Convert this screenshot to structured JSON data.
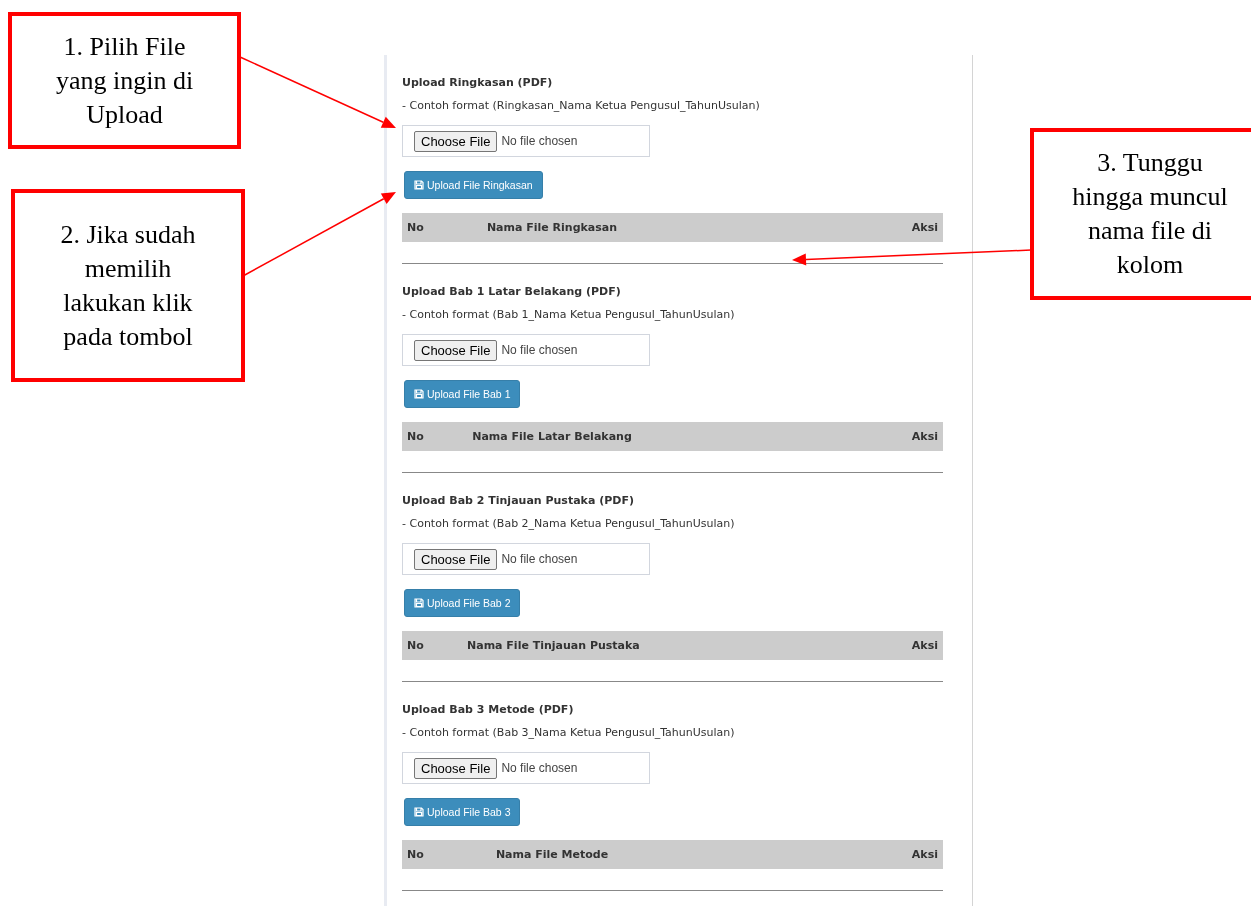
{
  "sections": [
    {
      "title": "Upload Ringkasan (PDF)",
      "hint": "- Contoh format (Ringkasan_Nama Ketua Pengusul_TahunUsulan)",
      "choose_button": "Choose File",
      "file_status": "No file chosen",
      "upload_button": "Upload File Ringkasan",
      "columns": [
        "No",
        "Nama File Ringkasan",
        "Aksi"
      ]
    },
    {
      "title": "Upload Bab 1 Latar Belakang (PDF)",
      "hint": "- Contoh format (Bab 1_Nama Ketua Pengusul_TahunUsulan)",
      "choose_button": "Choose File",
      "file_status": "No file chosen",
      "upload_button": "Upload File Bab 1",
      "columns": [
        "No",
        "Nama File Latar Belakang",
        "Aksi"
      ]
    },
    {
      "title": "Upload Bab 2 Tinjauan Pustaka (PDF)",
      "hint": "- Contoh format (Bab 2_Nama Ketua Pengusul_TahunUsulan)",
      "choose_button": "Choose File",
      "file_status": "No file chosen",
      "upload_button": "Upload File Bab 2",
      "columns": [
        "No",
        "Nama File Tinjauan Pustaka",
        "Aksi"
      ]
    },
    {
      "title": "Upload Bab 3 Metode (PDF)",
      "hint": "- Contoh format (Bab 3_Nama Ketua Pengusul_TahunUsulan)",
      "choose_button": "Choose File",
      "file_status": "No file chosen",
      "upload_button": "Upload File Bab 3",
      "columns": [
        "No",
        "Nama File Metode",
        "Aksi"
      ]
    }
  ],
  "callouts": [
    {
      "lines": [
        "1. Pilih File",
        "yang ingin di",
        "Upload"
      ]
    },
    {
      "lines": [
        "2. Jika sudah",
        "memilih",
        "lakukan klik",
        "pada tombol"
      ]
    },
    {
      "lines": [
        "3. Tunggu",
        "hingga muncul",
        "nama file di",
        "kolom"
      ]
    }
  ]
}
